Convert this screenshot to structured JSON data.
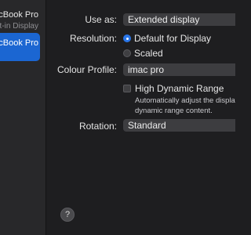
{
  "sidebar": {
    "devices": [
      {
        "name": "MacBook Pro",
        "subtitle": "Built-in Display"
      },
      {
        "name": "MacBook Pro"
      }
    ]
  },
  "form": {
    "use_as": {
      "label": "Use as:",
      "value": "Extended display"
    },
    "resolution": {
      "label": "Resolution:",
      "options": [
        "Default for Display",
        "Scaled"
      ],
      "selected": "Default for Display"
    },
    "colour_profile": {
      "label": "Colour Profile:",
      "value": "imac pro"
    },
    "hdr": {
      "label": "High Dynamic Range",
      "checked": false,
      "hint_line1": "Automatically adjust the display to show high",
      "hint_line2": "dynamic range content."
    },
    "rotation": {
      "label": "Rotation:",
      "value": "Standard"
    }
  },
  "help": {
    "glyph": "?",
    "icon": "help-icon"
  },
  "colors": {
    "accent": "#1b66d2",
    "background": "#1e1e20",
    "sidebar": "#28282a"
  }
}
